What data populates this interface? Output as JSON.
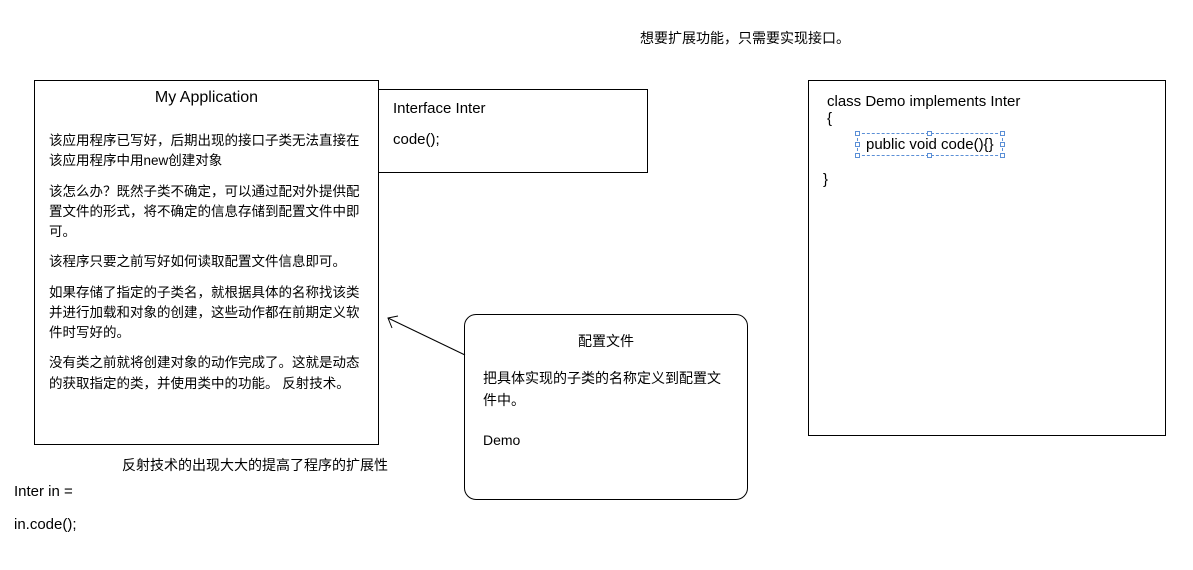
{
  "top_note": "想要扩展功能，只需要实现接口。",
  "my_app": {
    "title": "My Application",
    "p1": "该应用程序已写好，后期出现的接口子类无法直接在该应用程序中用new创建对象",
    "p2": "该怎么办？既然子类不确定，可以通过配对外提供配置文件的形式，将不确定的信息存储到配置文件中即可。",
    "p3": "该程序只要之前写好如何读取配置文件信息即可。",
    "p4": "如果存储了指定的子类名，就根据具体的名称找该类并进行加载和对象的创建，这些动作都在前期定义软件时写好的。",
    "p5": "没有类之前就将创建对象的动作完成了。这就是动态的获取指定的类，并使用类中的功能。  反射技术。"
  },
  "interface_box": {
    "line1": "Interface  Inter",
    "line2": "code();"
  },
  "config_box": {
    "title": "配置文件",
    "body": "把具体实现的子类的名称定义到配置文件中。",
    "demo": "Demo"
  },
  "demo_box": {
    "line1": "class Demo implements Inter",
    "brace_open": "{",
    "code": "public void code(){}",
    "brace_close": "}"
  },
  "reflect_note": "反射技术的出现大大的提高了程序的扩展性",
  "code_call1": "Inter in =",
  "code_call2": "in.code();"
}
